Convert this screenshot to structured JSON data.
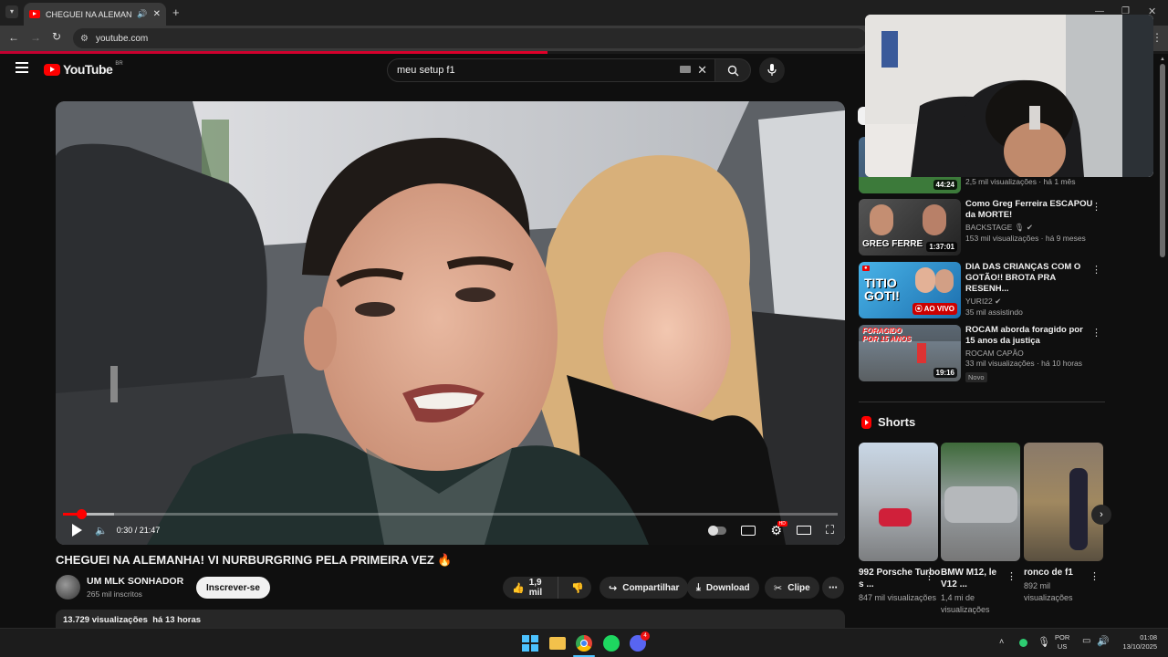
{
  "browser": {
    "tab_title": "CHEGUEI NA ALEMANHA! ",
    "url": "youtube.com"
  },
  "youtube": {
    "logo_text": "YouTube",
    "region": "BR",
    "search_query": "meu setup f1"
  },
  "player": {
    "time": "0:30 / 21:47",
    "progress_fraction": 0.023
  },
  "video": {
    "title": "CHEGUEI NA ALEMANHA! VI NURBURGRING PELA PRIMEIRA VEZ 🔥",
    "channel": "UM MLK SONHADOR",
    "subscribers": "265 mil inscritos",
    "subscribe_label": "Inscrever-se",
    "likes": "1,9 mil",
    "share_label": "Compartilhar",
    "download_label": "Download",
    "clip_label": "Clipe",
    "views_date": "13.729 visualizações  há 13 horas"
  },
  "recommendations": [
    {
      "title": "",
      "channel": "",
      "meta": "2,5 mil visualizações · há 1 mês",
      "duration": "44:24"
    },
    {
      "title": "Como Greg Ferreira ESCAPOU da MORTE!",
      "channel": "BACKSTAGE 🎙 ✔",
      "meta": "153 mil visualizações · há 9 meses",
      "duration": "1:37:01",
      "thumb_text": "GREG FERRE"
    },
    {
      "title": "DIA DAS CRIANÇAS COM O GOTÃO!! BROTA PRA RESENH...",
      "channel": "YURI22 ✔",
      "meta": "35 mil assistindo",
      "live_label": "AO VIVO",
      "thumb_text": "TITIO GOTI!"
    },
    {
      "title": "ROCAM aborda foragido por 15 anos da justiça",
      "channel": "ROCAM CAPÃO",
      "meta": "33 mil visualizações · há 10 horas",
      "duration": "19:16",
      "badge": "Novo",
      "thumb_text": "FORAGIDO POR 15 ANOS"
    }
  ],
  "shorts": {
    "heading": "Shorts",
    "items": [
      {
        "title": "992 Porsche Turbo s ...",
        "views": "847 mil visualizações"
      },
      {
        "title": "BMW M12, le V12 ...",
        "views": "1,4 mi de visualizações"
      },
      {
        "title": "ronco de f1",
        "views": "892 mil visualizações"
      }
    ]
  },
  "taskbar": {
    "language": "POR",
    "region": "US",
    "time": "01:08",
    "date": "13/10/2025",
    "discord_badge": "4"
  },
  "colors": {
    "youtube_red": "#ff0000",
    "background": "#0f0f0f",
    "pill": "#272727"
  }
}
